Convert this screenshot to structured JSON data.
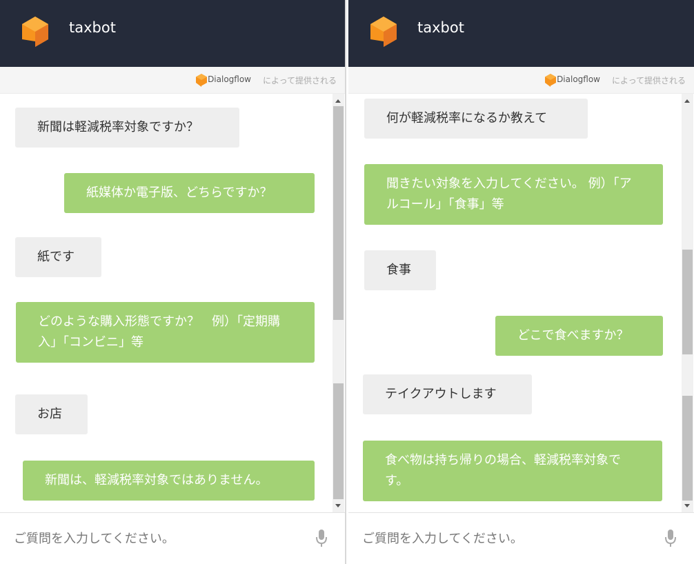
{
  "left": {
    "header": {
      "title": "taxbot"
    },
    "powered": {
      "brand": "Dialogflow",
      "by": "によって提供される"
    },
    "messages": [
      {
        "role": "user",
        "text": "新聞は軽減税率対象ですか？"
      },
      {
        "role": "bot",
        "text": "紙媒体か電子版、どちらですか？"
      },
      {
        "role": "user",
        "text": "紙です"
      },
      {
        "role": "bot",
        "text": "どのような購入形態ですか？　例）「定期購入」「コンビニ」等"
      },
      {
        "role": "user",
        "text": "お店"
      },
      {
        "role": "bot",
        "text": "新聞は、軽減税率対象ではありません。"
      }
    ],
    "input": {
      "placeholder": "ご質問を入力してください。"
    }
  },
  "right": {
    "header": {
      "title": "taxbot"
    },
    "powered": {
      "brand": "Dialogflow",
      "by": "によって提供される"
    },
    "messages": [
      {
        "role": "user",
        "text": "何が軽減税率になるか教えて"
      },
      {
        "role": "bot",
        "text": "聞きたい対象を入力してください。 例）「アルコール」「食事」等"
      },
      {
        "role": "user",
        "text": "食事"
      },
      {
        "role": "bot",
        "text": "どこで食べますか？"
      },
      {
        "role": "user",
        "text": "テイクアウトします"
      },
      {
        "role": "bot",
        "text": "食べ物は持ち帰りの場合、軽減税率対象です。"
      }
    ],
    "input": {
      "placeholder": "ご質問を入力してください。"
    }
  },
  "colors": {
    "header_bg": "#252b3a",
    "bot_bubble": "#a3d275",
    "user_bubble": "#eeeeee",
    "logo_orange": "#f7941e"
  }
}
